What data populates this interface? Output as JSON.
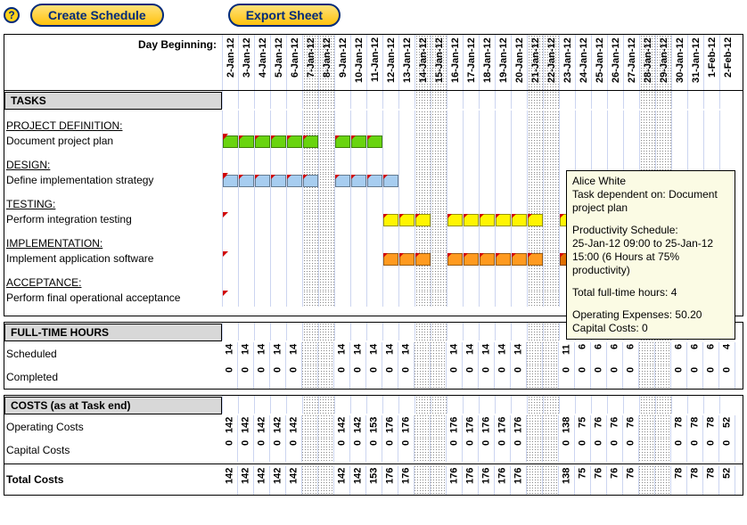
{
  "buttons": {
    "help": "?",
    "create": "Create Schedule",
    "export": "Export Sheet"
  },
  "header_label": "Day Beginning:",
  "dates": [
    "2-Jan-12",
    "3-Jan-12",
    "4-Jan-12",
    "5-Jan-12",
    "6-Jan-12",
    "7-Jan-12",
    "8-Jan-12",
    "9-Jan-12",
    "10-Jan-12",
    "11-Jan-12",
    "12-Jan-12",
    "13-Jan-12",
    "14-Jan-12",
    "15-Jan-12",
    "16-Jan-12",
    "17-Jan-12",
    "18-Jan-12",
    "19-Jan-12",
    "20-Jan-12",
    "21-Jan-12",
    "22-Jan-12",
    "23-Jan-12",
    "24-Jan-12",
    "25-Jan-12",
    "26-Jan-12",
    "27-Jan-12",
    "28-Jan-12",
    "29-Jan-12",
    "30-Jan-12",
    "31-Jan-12",
    "1-Feb-12",
    "2-Feb-12"
  ],
  "weekend_idx": [
    5,
    6,
    12,
    13,
    19,
    20,
    26,
    27
  ],
  "sections": {
    "tasks": "TASKS",
    "hours": "FULL-TIME HOURS",
    "costs": "COSTS (as at Task end)"
  },
  "task_groups": [
    {
      "group": "PROJECT DEFINITION:",
      "task": "Document project plan",
      "color": "green",
      "bars": [
        [
          0,
          5
        ],
        [
          7,
          9
        ]
      ],
      "tick_at": 0
    },
    {
      "group": "DESIGN:",
      "task": "Define implementation strategy",
      "color": "blue",
      "bars": [
        [
          0,
          5
        ],
        [
          7,
          10
        ]
      ],
      "tick_at": 0
    },
    {
      "group": "TESTING:",
      "task": "Perform integration testing",
      "color": "yellow",
      "bars": [
        [
          10,
          12
        ],
        [
          14,
          19
        ],
        [
          21,
          24
        ]
      ],
      "tick_at": 0
    },
    {
      "group": "IMPLEMENTATION:",
      "task": "Implement application software",
      "color": "orange",
      "bars": [
        [
          10,
          12
        ],
        [
          14,
          19
        ],
        [
          21,
          22
        ]
      ],
      "tick_at": 0,
      "darker": [
        21
      ]
    },
    {
      "group": "ACCEPTANCE:",
      "task": "Perform final operational acceptance",
      "color": "red",
      "bars": [
        [
          22,
          26
        ],
        [
          28,
          31
        ]
      ],
      "tick_at": 0
    }
  ],
  "hours": {
    "scheduled_label": "Scheduled",
    "completed_label": "Completed",
    "scheduled": [
      "14",
      "14",
      "14",
      "14",
      "14",
      "",
      "",
      "14",
      "14",
      "14",
      "14",
      "14",
      "",
      "",
      "14",
      "14",
      "14",
      "14",
      "14",
      "",
      "",
      "11",
      "6",
      "6",
      "6",
      "6",
      "",
      "",
      "6",
      "6",
      "6",
      "4"
    ],
    "completed": [
      "0",
      "0",
      "0",
      "0",
      "0",
      "",
      "",
      "0",
      "0",
      "0",
      "0",
      "0",
      "",
      "",
      "0",
      "0",
      "0",
      "0",
      "0",
      "",
      "",
      "0",
      "0",
      "0",
      "0",
      "0",
      "",
      "",
      "0",
      "0",
      "0",
      "0"
    ]
  },
  "costs": {
    "operating_label": "Operating Costs",
    "capital_label": "Capital Costs",
    "total_label": "Total Costs",
    "operating": [
      "142",
      "142",
      "142",
      "142",
      "142",
      "",
      "",
      "142",
      "142",
      "153",
      "176",
      "176",
      "",
      "",
      "176",
      "176",
      "176",
      "176",
      "176",
      "",
      "",
      "138",
      "75",
      "76",
      "76",
      "76",
      "",
      "",
      "78",
      "78",
      "78",
      "52"
    ],
    "capital": [
      "0",
      "0",
      "0",
      "0",
      "0",
      "",
      "",
      "0",
      "0",
      "0",
      "0",
      "0",
      "",
      "",
      "0",
      "0",
      "0",
      "0",
      "0",
      "",
      "",
      "0",
      "0",
      "0",
      "0",
      "0",
      "",
      "",
      "0",
      "0",
      "0",
      "0"
    ],
    "total": [
      "142",
      "142",
      "142",
      "142",
      "142",
      "",
      "",
      "142",
      "142",
      "153",
      "176",
      "176",
      "",
      "",
      "176",
      "176",
      "176",
      "176",
      "176",
      "",
      "",
      "138",
      "75",
      "76",
      "76",
      "76",
      "",
      "",
      "78",
      "78",
      "78",
      "52"
    ]
  },
  "tooltip": {
    "name": "Alice White",
    "dep": "Task dependent on: Document project plan",
    "ps_label": "Productivity Schedule:",
    "ps_line1": "25-Jan-12 09:00 to 25-Jan-12 15:00 (6 Hours at 75% productivity)",
    "hours": "Total full-time hours: 4",
    "opex": "Operating Expenses: 50.20",
    "capex": "Capital Costs: 0"
  },
  "chart_data": {
    "type": "bar",
    "title": "Project Gantt + resource/cost table",
    "x": [
      "2-Jan-12",
      "3-Jan-12",
      "4-Jan-12",
      "5-Jan-12",
      "6-Jan-12",
      "7-Jan-12",
      "8-Jan-12",
      "9-Jan-12",
      "10-Jan-12",
      "11-Jan-12",
      "12-Jan-12",
      "13-Jan-12",
      "14-Jan-12",
      "15-Jan-12",
      "16-Jan-12",
      "17-Jan-12",
      "18-Jan-12",
      "19-Jan-12",
      "20-Jan-12",
      "21-Jan-12",
      "22-Jan-12",
      "23-Jan-12",
      "24-Jan-12",
      "25-Jan-12",
      "26-Jan-12",
      "27-Jan-12",
      "28-Jan-12",
      "29-Jan-12",
      "30-Jan-12",
      "31-Jan-12",
      "1-Feb-12",
      "2-Feb-12"
    ],
    "gantt": [
      {
        "name": "Document project plan",
        "group": "PROJECT DEFINITION",
        "spans": [
          [
            "2-Jan-12",
            "6-Jan-12"
          ],
          [
            "9-Jan-12",
            "10-Jan-12"
          ]
        ]
      },
      {
        "name": "Define implementation strategy",
        "group": "DESIGN",
        "spans": [
          [
            "2-Jan-12",
            "6-Jan-12"
          ],
          [
            "9-Jan-12",
            "11-Jan-12"
          ]
        ]
      },
      {
        "name": "Perform integration testing",
        "group": "TESTING",
        "spans": [
          [
            "12-Jan-12",
            "13-Jan-12"
          ],
          [
            "16-Jan-12",
            "20-Jan-12"
          ],
          [
            "23-Jan-12",
            "25-Jan-12"
          ]
        ]
      },
      {
        "name": "Implement application software",
        "group": "IMPLEMENTATION",
        "spans": [
          [
            "12-Jan-12",
            "13-Jan-12"
          ],
          [
            "16-Jan-12",
            "20-Jan-12"
          ],
          [
            "23-Jan-12",
            "23-Jan-12"
          ]
        ]
      },
      {
        "name": "Perform final operational acceptance",
        "group": "ACCEPTANCE",
        "spans": [
          [
            "24-Jan-12",
            "27-Jan-12"
          ],
          [
            "30-Jan-12",
            "2-Feb-12"
          ]
        ]
      }
    ],
    "series": [
      {
        "name": "Scheduled full-time hours",
        "values": [
          14,
          14,
          14,
          14,
          14,
          null,
          null,
          14,
          14,
          14,
          14,
          14,
          null,
          null,
          14,
          14,
          14,
          14,
          14,
          null,
          null,
          11,
          6,
          6,
          6,
          6,
          null,
          null,
          6,
          6,
          6,
          4
        ]
      },
      {
        "name": "Completed full-time hours",
        "values": [
          0,
          0,
          0,
          0,
          0,
          null,
          null,
          0,
          0,
          0,
          0,
          0,
          null,
          null,
          0,
          0,
          0,
          0,
          0,
          null,
          null,
          0,
          0,
          0,
          0,
          0,
          null,
          null,
          0,
          0,
          0,
          0
        ]
      },
      {
        "name": "Operating Costs",
        "values": [
          142,
          142,
          142,
          142,
          142,
          null,
          null,
          142,
          142,
          153,
          176,
          176,
          null,
          null,
          176,
          176,
          176,
          176,
          176,
          null,
          null,
          138,
          75,
          76,
          76,
          76,
          null,
          null,
          78,
          78,
          78,
          52
        ]
      },
      {
        "name": "Capital Costs",
        "values": [
          0,
          0,
          0,
          0,
          0,
          null,
          null,
          0,
          0,
          0,
          0,
          0,
          null,
          null,
          0,
          0,
          0,
          0,
          0,
          null,
          null,
          0,
          0,
          0,
          0,
          0,
          null,
          null,
          0,
          0,
          0,
          0
        ]
      },
      {
        "name": "Total Costs",
        "values": [
          142,
          142,
          142,
          142,
          142,
          null,
          null,
          142,
          142,
          153,
          176,
          176,
          null,
          null,
          176,
          176,
          176,
          176,
          176,
          null,
          null,
          138,
          75,
          76,
          76,
          76,
          null,
          null,
          78,
          78,
          78,
          52
        ]
      }
    ]
  }
}
